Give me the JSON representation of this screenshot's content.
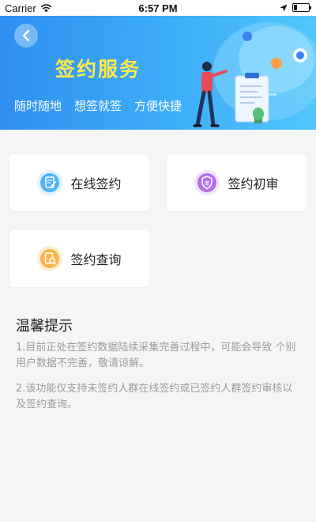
{
  "status_bar": {
    "carrier": "Carrier",
    "time": "6:57 PM",
    "battery_level": 0.2
  },
  "banner": {
    "title": "签约服务",
    "slogans": [
      "随时随地",
      "想签就签",
      "方便快捷"
    ],
    "back_icon": "chevron-left-icon"
  },
  "services": [
    {
      "label": "在线签约",
      "icon": "edit-document-icon",
      "color": "#4fb3f6"
    },
    {
      "label": "签约初审",
      "icon": "shield-review-icon",
      "color": "#b26ee8"
    },
    {
      "label": "签约查询",
      "icon": "document-search-icon",
      "color": "#f8b54a"
    }
  ],
  "tips": {
    "title": "温馨提示",
    "items": [
      "1.目前正处在签约数据陆续采集完善过程中，可能会导致 个别用户数据不完善，敬请谅解。",
      "2.该功能仅支持未签约人群在线签约或已签约人群签约审核以及签约查询。"
    ]
  },
  "colors": {
    "banner_start": "#2f8ff0",
    "banner_end": "#51c6fb",
    "title_yellow": "#ffe94a",
    "background": "#f4f5f7"
  }
}
